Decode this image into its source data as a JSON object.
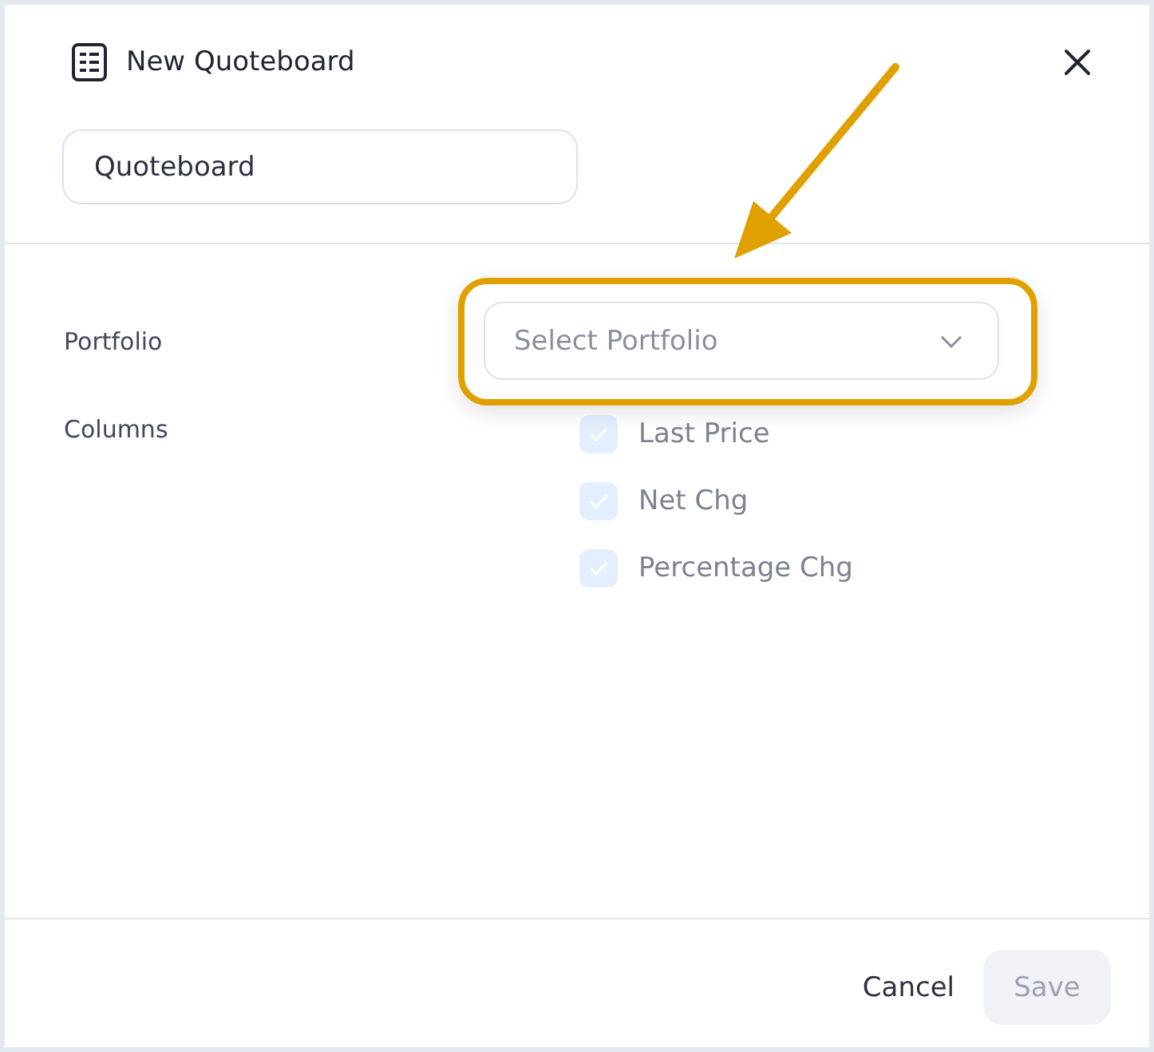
{
  "dialog": {
    "title": "New Quoteboard",
    "name_field": {
      "value": "Quoteboard"
    },
    "portfolio": {
      "label": "Portfolio",
      "placeholder": "Select Portfolio",
      "highlighted": true
    },
    "columns": {
      "label": "Columns",
      "options": [
        {
          "label": "Last Price",
          "checked": true,
          "disabled": true
        },
        {
          "label": "Net Chg",
          "checked": true,
          "disabled": true
        },
        {
          "label": "Percentage Chg",
          "checked": true,
          "disabled": true
        }
      ]
    },
    "buttons": [
      {
        "label": "Cancel",
        "kind": "text",
        "disabled": false
      },
      {
        "label": "Save",
        "kind": "primary",
        "disabled": true
      }
    ]
  }
}
